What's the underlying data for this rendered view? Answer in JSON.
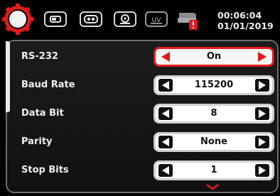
{
  "header": {
    "time": "00:06:04",
    "date": "01/01/2019",
    "tabs": [
      {
        "icon": "display-icon"
      },
      {
        "icon": "camera-icon"
      },
      {
        "icon": "webcam-icon"
      },
      {
        "icon": "uv-icon",
        "label": "UV"
      },
      {
        "icon": "printer-alert-icon"
      }
    ]
  },
  "settings": [
    {
      "label": "RS-232",
      "value": "On",
      "active": true
    },
    {
      "label": "Baud Rate",
      "value": "115200"
    },
    {
      "label": "Data Bit",
      "value": "8"
    },
    {
      "label": "Parity",
      "value": "None"
    },
    {
      "label": "Stop Bits",
      "value": "1"
    }
  ],
  "colors": {
    "accent": "#e21a1a",
    "background": "#000000",
    "panel_border": "#6f6f6f"
  }
}
